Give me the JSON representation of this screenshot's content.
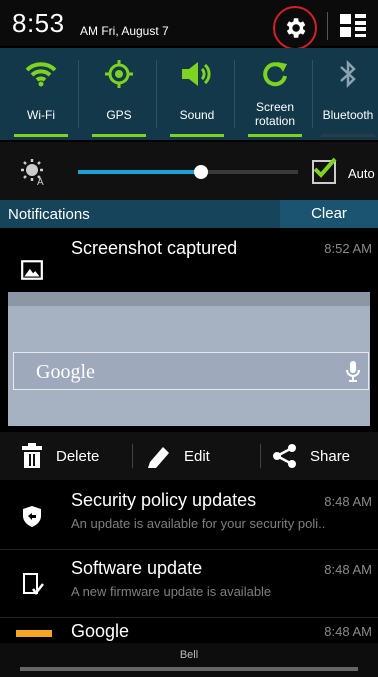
{
  "status_bar": {
    "time": "8:53",
    "ampm_date": "AM Fri, August 7",
    "settings_icon": "gear-icon",
    "grid_icon": "grid-toggle-icon"
  },
  "quick_settings": [
    {
      "label": "Wi-Fi",
      "icon": "wifi-icon",
      "active": true
    },
    {
      "label": "GPS",
      "icon": "gps-icon",
      "active": true
    },
    {
      "label": "Sound",
      "icon": "sound-icon",
      "active": true
    },
    {
      "label": "Screen\nrotation",
      "icon": "rotation-icon",
      "active": true
    },
    {
      "label": "Bluetooth",
      "icon": "bluetooth-icon",
      "active": false
    }
  ],
  "brightness": {
    "level": 0.56,
    "auto_label": "Auto",
    "auto_checked": true
  },
  "notifications_header": {
    "title": "Notifications",
    "clear_label": "Clear"
  },
  "screenshot_notification": {
    "title": "Screenshot captured",
    "time": "8:52 AM",
    "preview": {
      "search_text": "Google"
    },
    "actions": {
      "delete": "Delete",
      "edit": "Edit",
      "share": "Share"
    }
  },
  "notifications": [
    {
      "title": "Security policy updates",
      "subtitle": "An update is available for your security poli..",
      "time": "8:48 AM",
      "icon": "shield-icon"
    },
    {
      "title": "Software update",
      "subtitle": "A new firmware update is available",
      "time": "8:48 AM",
      "icon": "phone-update-icon"
    },
    {
      "title": "Google",
      "subtitle": "",
      "time": "8:48 AM",
      "icon": "google-icon"
    }
  ],
  "bottom": {
    "label": "Bell"
  },
  "colors": {
    "accent_green": "#7ed321",
    "quick_settings_bg": "#12384a",
    "header_bg": "#16455b",
    "slider_blue": "#1e9fd8",
    "settings_ring": "#d4202a"
  }
}
